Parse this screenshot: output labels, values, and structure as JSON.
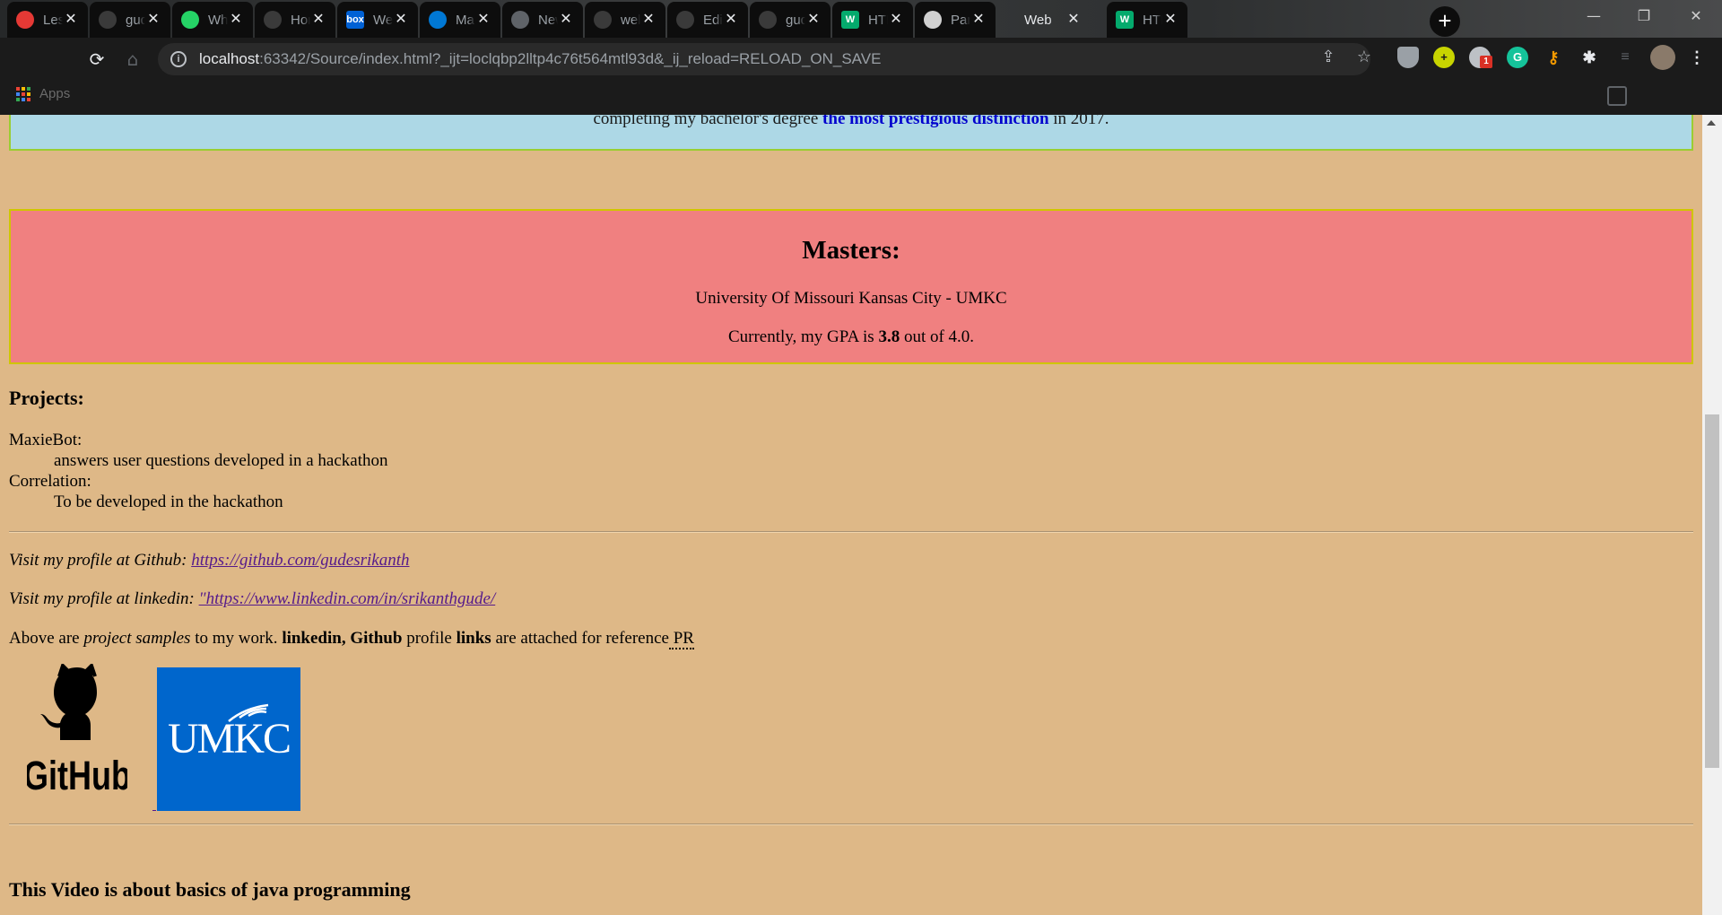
{
  "browser": {
    "tabs": [
      {
        "title": "Lesso",
        "favicon": "red-gear-icon"
      },
      {
        "title": "gude",
        "favicon": "github-icon"
      },
      {
        "title": "Wha",
        "favicon": "whatsapp-icon"
      },
      {
        "title": "Hom",
        "favicon": "github-icon"
      },
      {
        "title": "Web",
        "favicon": "box-icon",
        "favicon_text": "box"
      },
      {
        "title": "Mail",
        "favicon": "outlook-icon"
      },
      {
        "title": "New",
        "favicon": "globe-icon"
      },
      {
        "title": "web",
        "favicon": "github-icon"
      },
      {
        "title": "Editi",
        "favicon": "github-icon"
      },
      {
        "title": "gude",
        "favicon": "github-icon"
      },
      {
        "title": "HTM",
        "favicon": "w3schools-icon",
        "favicon_text": "W"
      },
      {
        "title": "Para",
        "favicon": "quill-icon"
      },
      {
        "title": "Web",
        "favicon": "none",
        "active": true
      },
      {
        "title": "HTM",
        "favicon": "w3schools-icon",
        "favicon_text": "W"
      }
    ],
    "new_tab_symbol": "+",
    "window_controls": {
      "minimize": "—",
      "maximize": "❐",
      "close": "✕"
    },
    "url": {
      "host": "localhost",
      "rest": ":63342/Source/index.html?_ijt=loclqbp2lltp4c76t564mtl93d&_ij_reload=RELOAD_ON_SAVE"
    },
    "extension_badge": "1",
    "bookmarks_apps_label": "Apps"
  },
  "page": {
    "bachelor": {
      "text_before": "completing my bachelor's degree ",
      "highlight": "the most prestigious distinction",
      "text_after": " in 2017."
    },
    "masters": {
      "title": "Masters:",
      "university": "University Of Missouri Kansas City - UMKC",
      "gpa_prefix": "Currently, my GPA is ",
      "gpa_value": "3.8",
      "gpa_suffix": " out of 4.0."
    },
    "projects": {
      "title": "Projects:",
      "items": [
        {
          "name": "MaxieBot:",
          "description": "answers user questions developed in a hackathon"
        },
        {
          "name": "Correlation:",
          "description": "To be developed in the hackathon"
        }
      ]
    },
    "profiles": {
      "github_label": "Visit my profile at Github: ",
      "github_link": "https://github.com/gudesrikanth",
      "linkedin_label": "Visit my profile at linkedin: ",
      "linkedin_link": "\"https://www.linkedin.com/in/srikanthgude/"
    },
    "above": {
      "t1": "Above are ",
      "t2": "project samples",
      "t3": " to my work. ",
      "t4": "linkedin, Github",
      "t5": " profile ",
      "t6": "links",
      "t7": " are attached for reference",
      "abbr": " PR"
    },
    "logos": {
      "github_text": "GitHub",
      "umkc_text": "UMKC"
    },
    "video_title": "This Video is about basics of java programming"
  }
}
